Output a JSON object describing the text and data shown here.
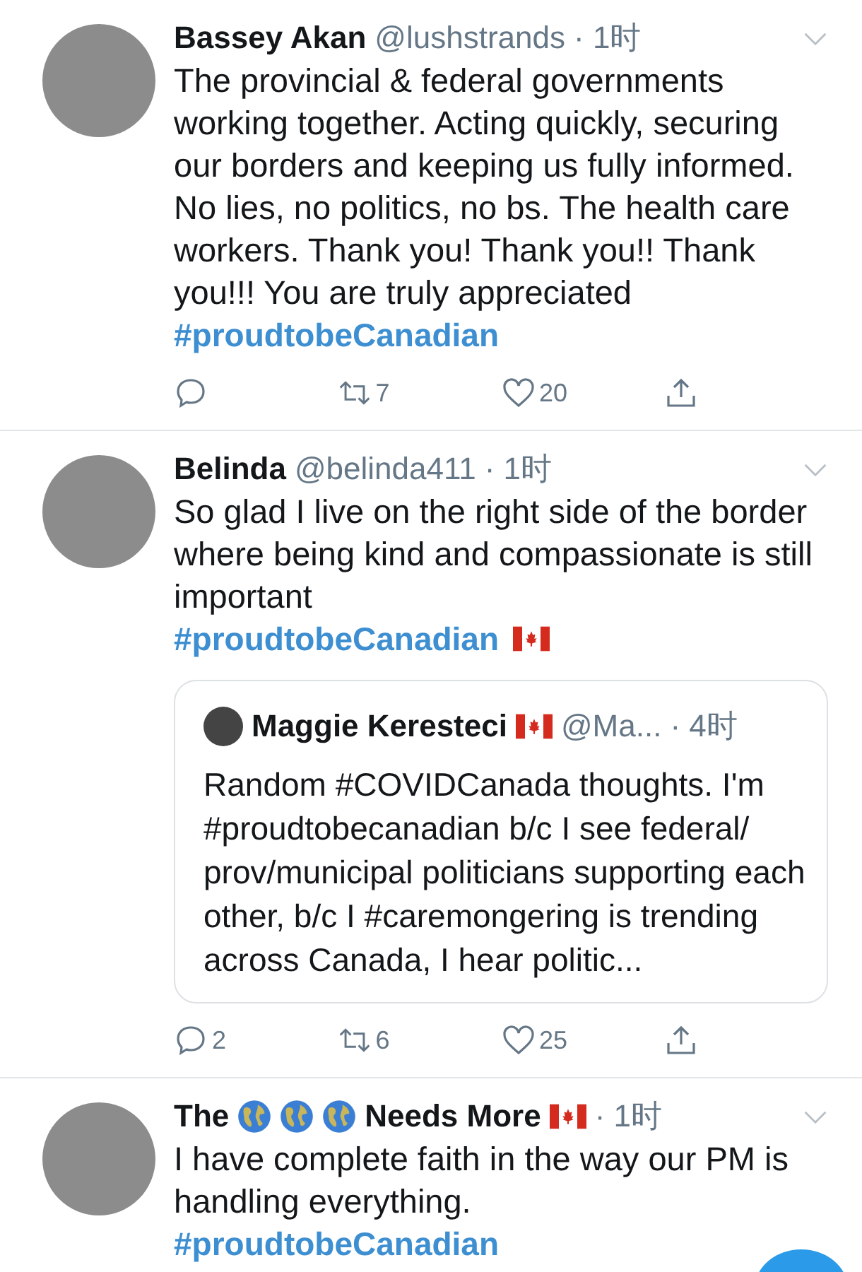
{
  "tweets": [
    {
      "author": [
        {
          "kind": "text",
          "text": "Bassey Akan"
        }
      ],
      "handle": "@lushstrands",
      "time": "· 1时",
      "body": "The provincial & federal governments working together. Acting quickly, securing our borders and keeping us fully informed. No lies, no politics, no bs. The health care workers. Thank you! Thank you!! Thank you!!! You are truly appreciated",
      "hashtag": "#proudtobeCanadian",
      "actions": [
        {
          "kind": "reply"
        },
        {
          "kind": "retweet",
          "count": "7"
        },
        {
          "kind": "like",
          "count": "20"
        },
        {
          "kind": "share"
        }
      ]
    },
    {
      "author": [
        {
          "kind": "text",
          "text": "Belinda"
        }
      ],
      "handle": "@belinda411",
      "time": "· 1时",
      "body": "So glad I live on the right side of the border where being kind and compassionate is still important",
      "hashtag": "#proudtobeCanadian",
      "hashtag_emoji": [
        {
          "kind": "flag"
        }
      ],
      "quote": {
        "author": [
          {
            "kind": "text",
            "text": "Maggie Keresteci"
          },
          {
            "kind": "flag"
          }
        ],
        "handle": "@Ma...",
        "time": "· 4时",
        "body": "Random #COVIDCanada thoughts. I'm #proudtobecanadian b/c I see federal/ prov/municipal politicians supporting each other, b/c I #caremongering is trending across Canada, I hear politic..."
      },
      "actions": [
        {
          "kind": "reply",
          "count": "2"
        },
        {
          "kind": "retweet",
          "count": "6"
        },
        {
          "kind": "like",
          "count": "25"
        },
        {
          "kind": "share"
        }
      ]
    },
    {
      "author": [
        {
          "kind": "text",
          "text": "The"
        },
        {
          "kind": "globe"
        },
        {
          "kind": "globe"
        },
        {
          "kind": "globe"
        },
        {
          "kind": "text",
          "text": "Needs More"
        },
        {
          "kind": "flag"
        }
      ],
      "time": "· 1时",
      "body": "I have complete faith in the way our PM is handling everything.",
      "hashtag": "#proudtobeCanadian"
    }
  ]
}
